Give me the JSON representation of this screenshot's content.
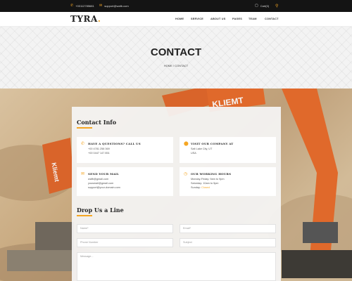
{
  "topbar": {
    "phone": "+00112785681",
    "email": "support@wafb.com",
    "cart_label": "Cart(0)",
    "phone_icon": "phone-icon",
    "email_icon": "envelope-icon",
    "cart_icon": "cart-icon",
    "search_icon": "search-icon"
  },
  "header": {
    "logo_text": "TYRA",
    "logo_dot": ".",
    "nav": [
      "HOME",
      "SERVICE",
      "ABOUT US",
      "PAGES",
      "TEAM",
      "CONTACT"
    ]
  },
  "banner": {
    "title": "CONTACT",
    "breadcrumb_home": "HOME",
    "breadcrumb_sep": "/",
    "breadcrumb_current": "CONTACT"
  },
  "contact_info": {
    "title": "Contact Info",
    "cards": [
      {
        "icon": "phone-icon",
        "title": "HAVE A QUESTIONS? CALL US",
        "lines": [
          "+00 4781 258 369",
          "+00 0447 147 851"
        ]
      },
      {
        "icon": "map-marker-icon",
        "title": "VISIT OUR COMPANY AT",
        "lines": [
          "Salt Lake City, UT",
          "USA"
        ]
      },
      {
        "icon": "envelope-icon",
        "title": "SEND YOUR MAIL",
        "lines": [
          "wafb@gmail.com",
          "yousmail@gmail.com",
          "support@your-domain.com"
        ]
      },
      {
        "icon": "clock-icon",
        "title": "OUR WORKING HOURS",
        "lines": [
          "Monday-Friday: 9am to 9pm",
          "Saturday: 10am to 5pm"
        ],
        "extra_label": "Sunday:",
        "extra_value": "Closed"
      }
    ]
  },
  "form": {
    "title": "Drop Us a Line",
    "name_placeholder": "Name*",
    "email_placeholder": "Email*",
    "phone_placeholder": "Phone Number",
    "subject_placeholder": "Subject",
    "message_placeholder": "Message..."
  },
  "colors": {
    "accent": "#f5a623",
    "topbar": "#141414"
  }
}
